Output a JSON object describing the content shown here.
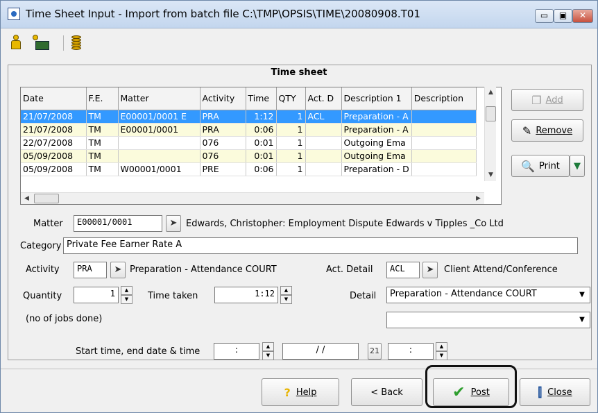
{
  "window": {
    "title": "Time Sheet Input - Import from batch file C:\\TMP\\OPSIS\\TIME\\20080908.T01",
    "controls": {
      "minimize": "▭",
      "maximize": "▣",
      "close": "✕"
    }
  },
  "toolbar": {
    "icons": [
      "person-icon",
      "person-folder-icon",
      "coins-icon"
    ]
  },
  "timesheet": {
    "title": "Time sheet",
    "columns": [
      "Date",
      "F.E.",
      "Matter",
      "Activity",
      "Time",
      "QTY",
      "Act. D",
      "Description 1",
      "Description"
    ],
    "rows": [
      {
        "date": "21/07/2008",
        "fe": "TM",
        "matter": "E00001/0001 E",
        "activity": "PRA",
        "time": "1:12",
        "qty": "1",
        "actd": "ACL",
        "desc1": "Preparation - A",
        "desc2": ""
      },
      {
        "date": "21/07/2008",
        "fe": "TM",
        "matter": "E00001/0001",
        "activity": "PRA",
        "time": "0:06",
        "qty": "1",
        "actd": "",
        "desc1": "Preparation - A",
        "desc2": ""
      },
      {
        "date": "22/07/2008",
        "fe": "TM",
        "matter": "",
        "activity": "076",
        "time": "0:01",
        "qty": "1",
        "actd": "",
        "desc1": "Outgoing Ema",
        "desc2": ""
      },
      {
        "date": "05/09/2008",
        "fe": "TM",
        "matter": "",
        "activity": "076",
        "time": "0:01",
        "qty": "1",
        "actd": "",
        "desc1": "Outgoing Ema",
        "desc2": ""
      },
      {
        "date": "05/09/2008",
        "fe": "TM",
        "matter": "W00001/0001",
        "activity": "PRE",
        "time": "0:06",
        "qty": "1",
        "actd": "",
        "desc1": "Preparation - D",
        "desc2": ""
      }
    ],
    "selected_row": 0
  },
  "side_buttons": {
    "add": "Add",
    "remove": "Remove",
    "print": "Print"
  },
  "form": {
    "matter_label": "Matter",
    "matter_value": "E00001/0001",
    "matter_desc": "Edwards, Christopher: Employment Dispute Edwards v Tipples _Co Ltd",
    "category_label": "Category",
    "category_value": "Private Fee Earner Rate A",
    "activity_label": "Activity",
    "activity_value": "PRA",
    "activity_desc": "Preparation - Attendance COURT",
    "actdetail_label": "Act. Detail",
    "actdetail_value": "ACL",
    "actdetail_desc": "Client Attend/Conference",
    "quantity_label": "Quantity",
    "quantity_value": "1",
    "timetaken_label": "Time taken",
    "timetaken_value": "1:12",
    "detail_label": "Detail",
    "detail_value": "Preparation - Attendance COURT",
    "detail2_value": "",
    "jobs_note": "(no of jobs done)",
    "start_label": "Start time, end date & time",
    "start_time": ":",
    "end_date": "/   /",
    "end_time": ":"
  },
  "bottom_buttons": {
    "help": "Help",
    "back": "< Back",
    "post": "Post",
    "close": "Close"
  },
  "colors": {
    "selection": "#3399ff",
    "alt_row": "#fbfbdc",
    "post_check": "#2e9e2e",
    "help_icon": "#e8b400"
  }
}
